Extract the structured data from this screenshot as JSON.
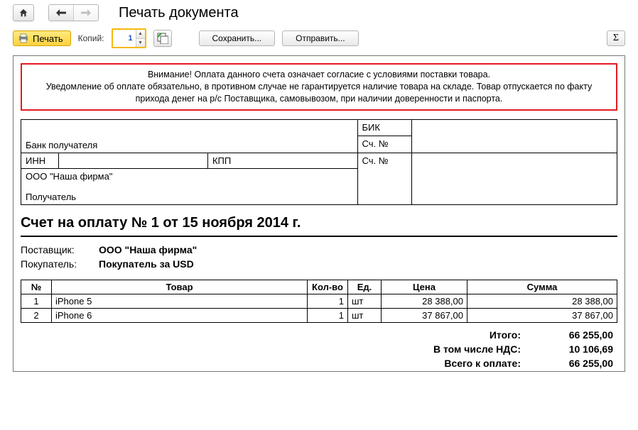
{
  "header": {
    "title": "Печать документа"
  },
  "toolbar": {
    "print_label": "Печать",
    "copies_label": "Копий:",
    "copies_value": "1",
    "save_label": "Сохранить...",
    "send_label": "Отправить..."
  },
  "warning": {
    "line1": "Внимание! Оплата данного счета означает согласие с условиями поставки товара.",
    "line2": "Уведомление об оплате обязательно, в противном случае не гарантируется наличие товара на складе. Товар отпускается по факту прихода денег на р/с Поставщика, самовывозом, при наличии доверенности и паспорта."
  },
  "bank": {
    "recipient_bank_label": "Банк получателя",
    "bik_label": "БИК",
    "account1_label": "Сч. №",
    "inn_label": "ИНН",
    "kpp_label": "КПП",
    "account2_label": "Сч. №",
    "company": "ООО \"Наша фирма\"",
    "recipient_label": "Получатель"
  },
  "doc": {
    "title": "Счет на оплату № 1 от 15 ноября 2014 г.",
    "supplier_label": "Поставщик:",
    "supplier_value": "ООО \"Наша фирма\"",
    "buyer_label": "Покупатель:",
    "buyer_value": "Покупатель за USD"
  },
  "table": {
    "headers": {
      "num": "№",
      "name": "Товар",
      "qty": "Кол-во",
      "unit": "Ед.",
      "price": "Цена",
      "sum": "Сумма"
    },
    "rows": [
      {
        "num": "1",
        "name": "iPhone 5",
        "qty": "1",
        "unit": "шт",
        "price": "28 388,00",
        "sum": "28 388,00"
      },
      {
        "num": "2",
        "name": "iPhone 6",
        "qty": "1",
        "unit": "шт",
        "price": "37 867,00",
        "sum": "37 867,00"
      }
    ]
  },
  "totals": {
    "subtotal_label": "Итого:",
    "subtotal_value": "66 255,00",
    "vat_label": "В том числе НДС:",
    "vat_value": "10 106,69",
    "total_label": "Всего к оплате:",
    "total_value": "66 255,00"
  }
}
